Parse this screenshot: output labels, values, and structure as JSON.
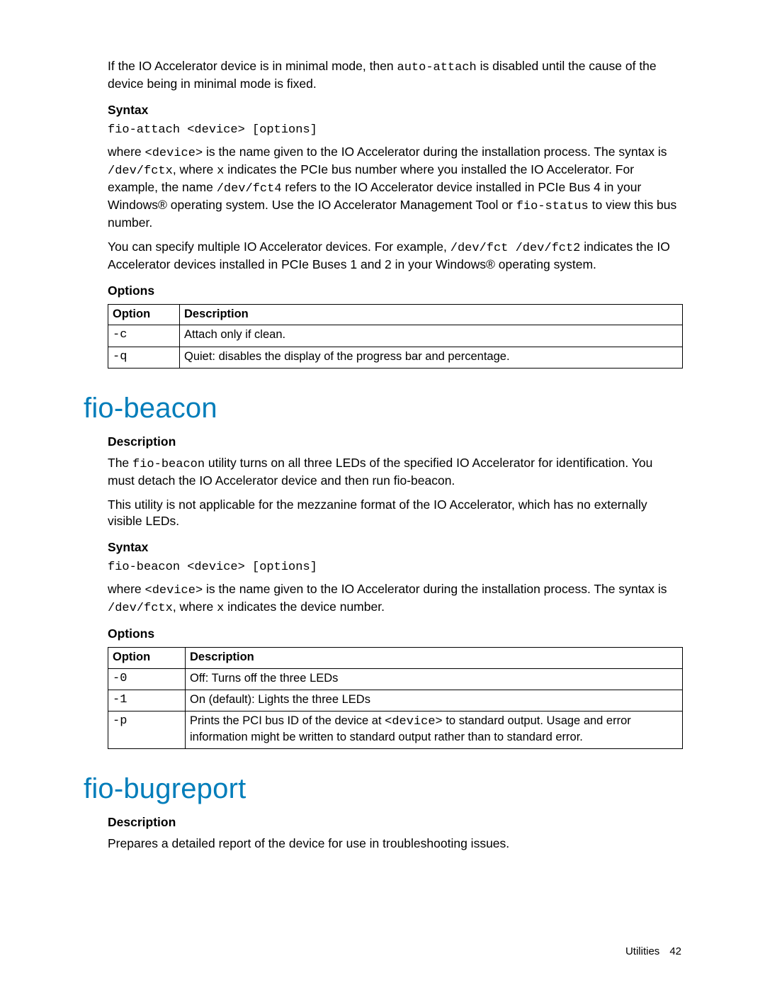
{
  "intro": {
    "p1_a": "If the IO Accelerator device is in minimal mode, then ",
    "p1_code": "auto-attach",
    "p1_b": " is disabled until the cause of the device being in minimal mode is fixed."
  },
  "attach": {
    "syntax_label": "Syntax",
    "syntax_code": "fio-attach <device> [options]",
    "where_a": "where ",
    "where_code1": "<device>",
    "where_b": " is the name given to the IO Accelerator during the installation process. The syntax is ",
    "where_code2": "/dev/fctx",
    "where_c": ", where ",
    "where_code3": "x",
    "where_d": " indicates the PCIe bus number where you installed the IO Accelerator. For example, the name ",
    "where_code4": "/dev/fct4",
    "where_e": " refers to the IO Accelerator device installed in PCIe Bus 4 in your Windows® operating system. Use the IO Accelerator Management Tool or ",
    "where_code5": "fio-status",
    "where_f": " to view this bus number.",
    "multi_a": "You can specify multiple IO Accelerator devices. For example, ",
    "multi_code": "/dev/fct /dev/fct2",
    "multi_b": " indicates the IO Accelerator devices installed in PCIe Buses 1 and 2 in your Windows® operating system.",
    "options_label": "Options",
    "table": {
      "h_option": "Option",
      "h_desc": "Description",
      "rows": [
        {
          "opt": "-c",
          "desc": "Attach only if clean."
        },
        {
          "opt": "-q",
          "desc": "Quiet: disables the display of the progress bar and percentage."
        }
      ]
    }
  },
  "beacon": {
    "heading": "fio-beacon",
    "desc_label": "Description",
    "p1_a": "The ",
    "p1_code": "fio-beacon",
    "p1_b": " utility turns on all three LEDs of the specified IO Accelerator for identification. You must detach the IO Accelerator device and then run fio-beacon.",
    "p2": "This utility is not applicable for the mezzanine format of the IO Accelerator, which has no externally visible LEDs.",
    "syntax_label": "Syntax",
    "syntax_code": "fio-beacon <device> [options]",
    "where_a": "where ",
    "where_code1": "<device>",
    "where_b": " is the name given to the IO Accelerator during the installation process. The syntax is ",
    "where_code2": "/dev/fctx",
    "where_c": ", where ",
    "where_code3": "x",
    "where_d": " indicates the device number.",
    "options_label": "Options",
    "table": {
      "h_option": "Option",
      "h_desc": "Description",
      "rows": [
        {
          "opt": "-0",
          "desc": "Off: Turns off the three LEDs"
        },
        {
          "opt": "-1",
          "desc": "On (default): Lights the three LEDs"
        },
        {
          "opt": "-p",
          "desc_a": "Prints the PCI bus ID of the device at ",
          "desc_code": "<device>",
          "desc_b": " to standard output. Usage and error information might be written to standard output rather than to standard error."
        }
      ]
    }
  },
  "bugreport": {
    "heading": "fio-bugreport",
    "desc_label": "Description",
    "p1": "Prepares a detailed report of the device for use in troubleshooting issues."
  },
  "footer": {
    "section": "Utilities",
    "page": "42"
  }
}
